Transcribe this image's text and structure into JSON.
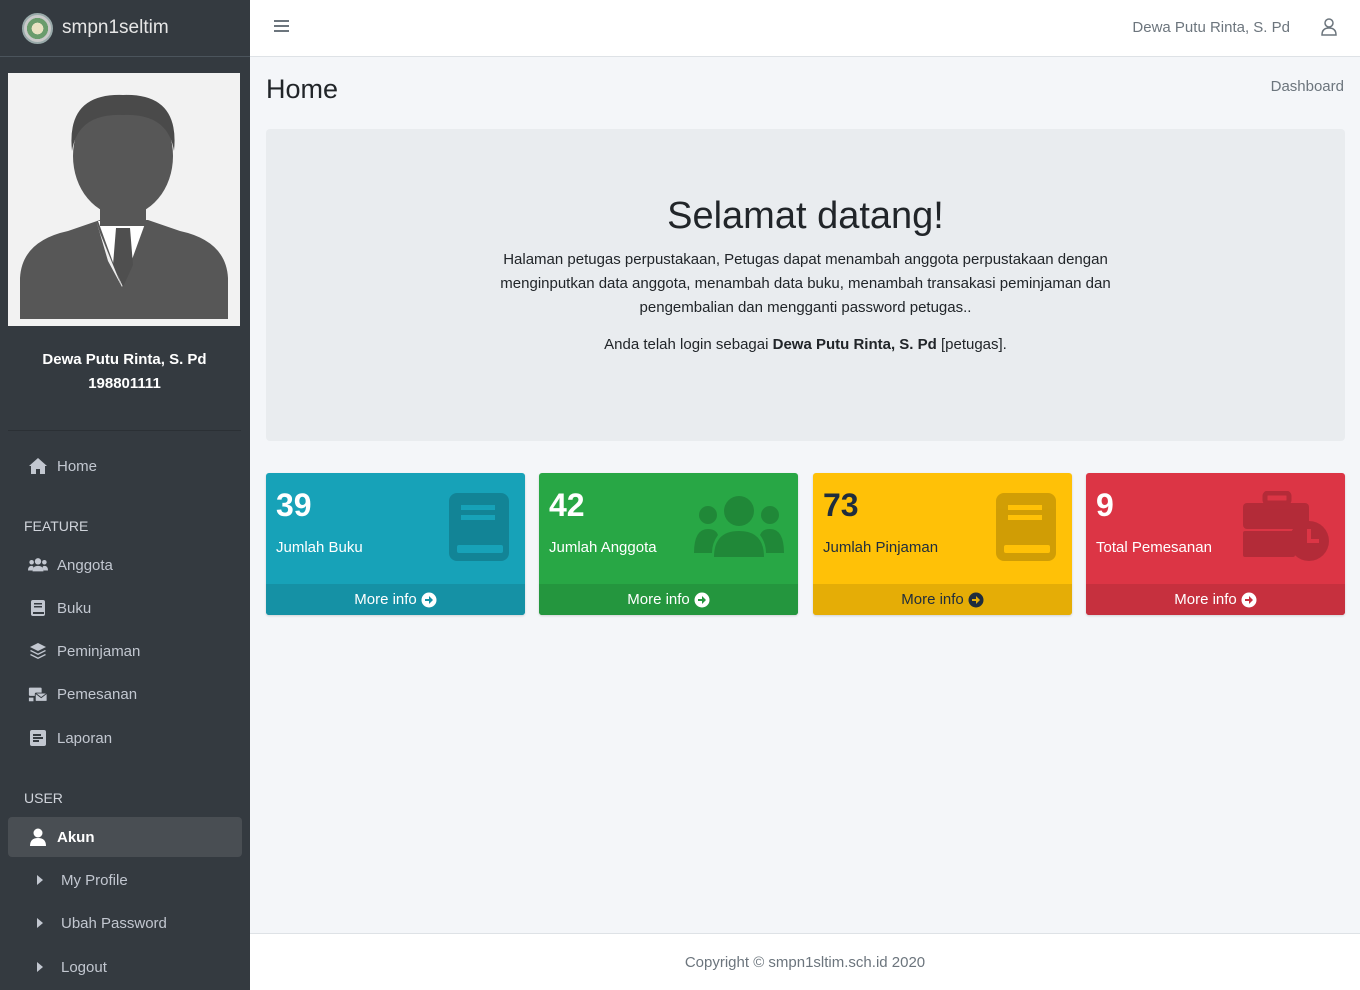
{
  "brand": {
    "name": "smpn1seltim"
  },
  "navbar": {
    "user_name": "Dewa Putu Rinta, S. Pd",
    "menu_icon": "bars-icon",
    "user_icon": "user-icon"
  },
  "user": {
    "name": "Dewa Putu Rinta, S. Pd",
    "id": "198801111"
  },
  "sidebar": {
    "home": {
      "label": "Home",
      "icon": "home-icon"
    },
    "feature_header": "FEATURE",
    "feature_items": [
      {
        "label": "Anggota",
        "icon": "users-icon"
      },
      {
        "label": "Buku",
        "icon": "book-icon"
      },
      {
        "label": "Peminjaman",
        "icon": "layers-icon"
      },
      {
        "label": "Pemesanan",
        "icon": "mail-bulk-icon"
      },
      {
        "label": "Laporan",
        "icon": "report-icon"
      }
    ],
    "user_header": "USER",
    "akun": {
      "label": "Akun",
      "icon": "user-icon"
    },
    "user_items": [
      {
        "label": "My Profile",
        "icon": "caret-right-icon"
      },
      {
        "label": "Ubah Password",
        "icon": "caret-right-icon"
      },
      {
        "label": "Logout",
        "icon": "caret-right-icon"
      }
    ]
  },
  "page": {
    "title": "Home",
    "breadcrumb": "Dashboard"
  },
  "jumbotron": {
    "heading": "Selamat datang!",
    "lead": "Halaman petugas perpustakaan, Petugas dapat menambah anggota perpustakaan dengan menginputkan data anggota, menambah data buku, menambah transakasi peminjaman dan pengembalian dan mengganti password petugas..",
    "login_prefix": "Anda telah login sebagai",
    "login_name": "Dewa Putu Rinta, S. Pd",
    "login_role": "[petugas]."
  },
  "boxes": [
    {
      "value": "39",
      "label": "Jumlah Buku",
      "more": "More info",
      "color": "#17a2b8",
      "footer_color": "#1591a5",
      "icon": "book-icon"
    },
    {
      "value": "42",
      "label": "Jumlah Anggota",
      "more": "More info",
      "color": "#28a745",
      "footer_color": "#24963e",
      "icon": "users-icon"
    },
    {
      "value": "73",
      "label": "Jumlah Pinjaman",
      "more": "More info",
      "color": "#ffc107",
      "footer_color": "#e5ad06",
      "icon": "book-icon"
    },
    {
      "value": "9",
      "label": "Total Pemesanan",
      "more": "More info",
      "color": "#dc3545",
      "footer_color": "#c6303e",
      "icon": "business-time-icon"
    }
  ],
  "footer": {
    "text": "Copyright © smpn1sltim.sch.id 2020"
  }
}
